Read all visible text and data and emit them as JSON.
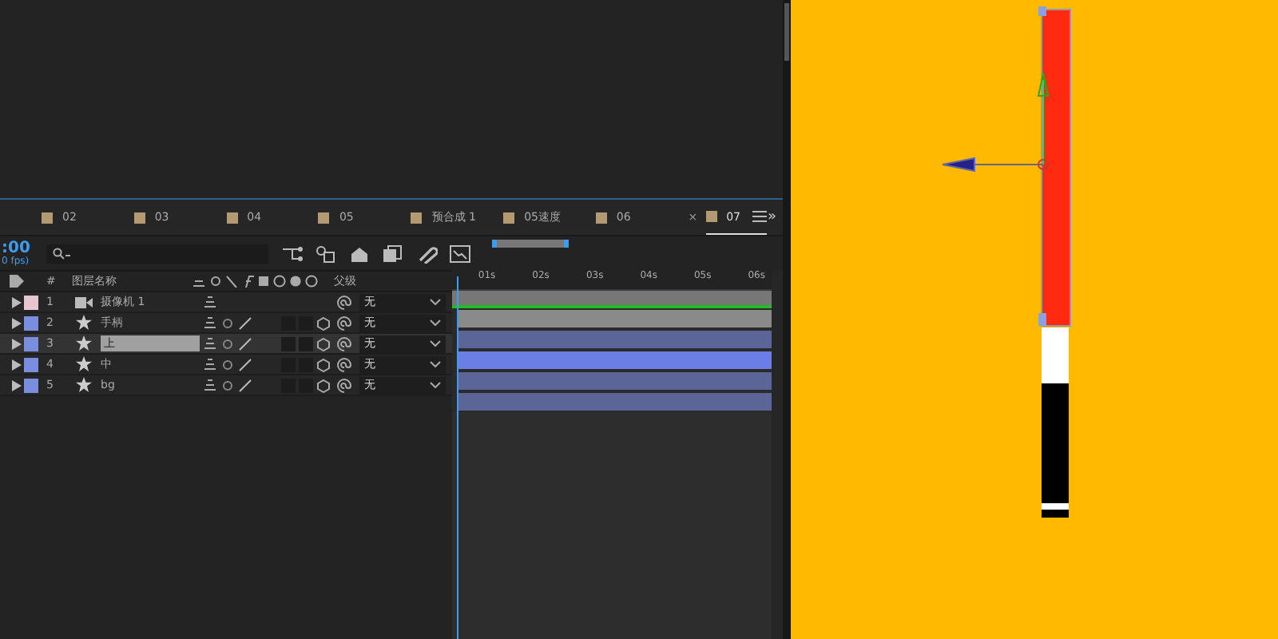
{
  "timecode": ":00",
  "fps": "0 fps)",
  "tabs": [
    {
      "label": "02",
      "selected": false
    },
    {
      "label": "03",
      "selected": false
    },
    {
      "label": "04",
      "selected": false
    },
    {
      "label": "05",
      "selected": false
    },
    {
      "label": "预合成 1",
      "selected": false
    },
    {
      "label": "05速度",
      "selected": false
    },
    {
      "label": "06",
      "selected": false
    },
    {
      "label": "07",
      "selected": true
    }
  ],
  "close_tab": "×",
  "more_tabs": "»",
  "columns": {
    "number": "#",
    "layer_name": "图层名称",
    "parent": "父级"
  },
  "layers": [
    {
      "number": "1",
      "name": "摄像机 1",
      "kind": "camera",
      "color": "#e8c4d0",
      "selected": false,
      "parent": "无"
    },
    {
      "number": "2",
      "name": "手柄",
      "kind": "shape",
      "color": "#7a8ee0",
      "selected": false,
      "parent": "无"
    },
    {
      "number": "3",
      "name": "上",
      "kind": "shape",
      "color": "#7a8ee0",
      "selected": true,
      "parent": "无"
    },
    {
      "number": "4",
      "name": "中",
      "kind": "shape",
      "color": "#7a8ee0",
      "selected": false,
      "parent": "无"
    },
    {
      "number": "5",
      "name": "bg",
      "kind": "shape",
      "color": "#7a8ee0",
      "selected": false,
      "parent": "无"
    }
  ],
  "ruler": [
    "01s",
    "02s",
    "03s",
    "04s",
    "05s",
    "06s"
  ]
}
